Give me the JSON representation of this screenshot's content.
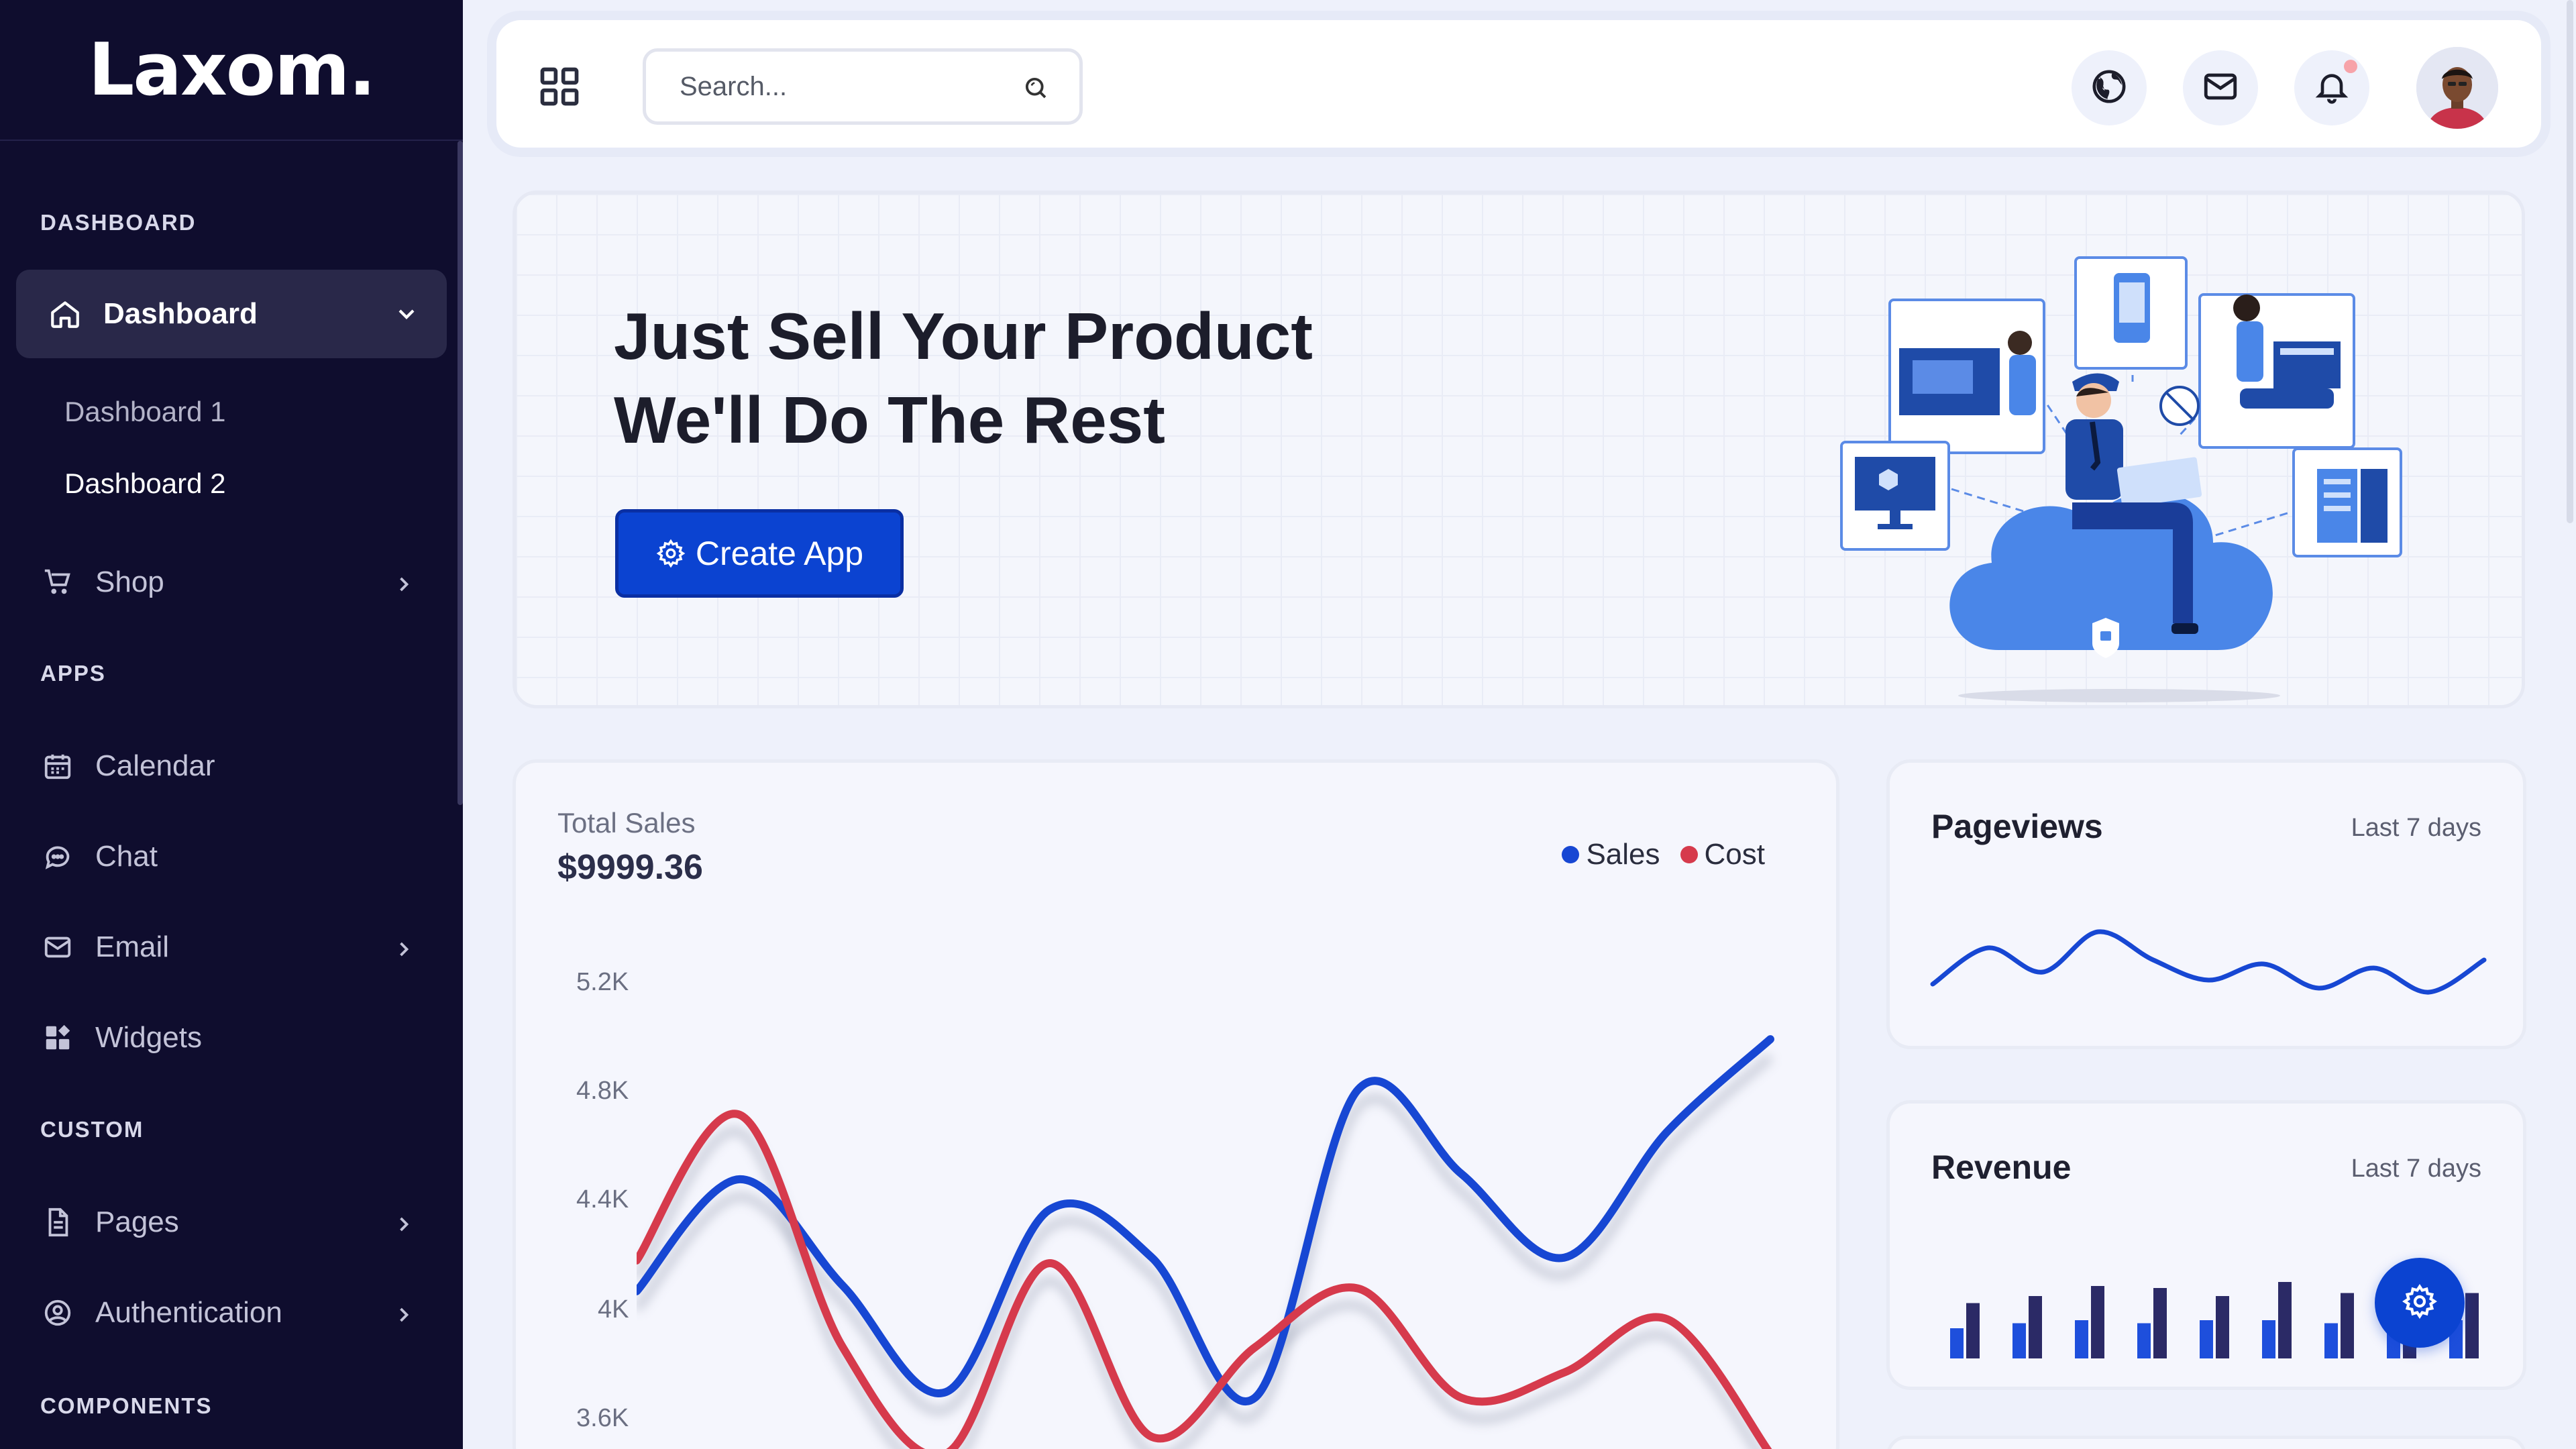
{
  "brand": {
    "logo": "Laxom."
  },
  "sidebar": {
    "sections": {
      "dashboard": "DASHBOARD",
      "apps": "APPS",
      "custom": "CUSTOM",
      "components": "COMPONENTS"
    },
    "active": {
      "label": "Dashboard",
      "icon": "home-icon"
    },
    "sub_items": [
      {
        "label": "Dashboard 1",
        "active": false
      },
      {
        "label": "Dashboard 2",
        "active": true
      }
    ],
    "items": [
      {
        "label": "Shop",
        "icon": "cart-icon",
        "has_children": true
      },
      {
        "label": "Calendar",
        "icon": "calendar-icon",
        "has_children": false
      },
      {
        "label": "Chat",
        "icon": "chat-icon",
        "has_children": false
      },
      {
        "label": "Email",
        "icon": "mail-icon",
        "has_children": true
      },
      {
        "label": "Widgets",
        "icon": "widgets-icon",
        "has_children": false
      },
      {
        "label": "Pages",
        "icon": "document-icon",
        "has_children": true
      },
      {
        "label": "Authentication",
        "icon": "user-circle-icon",
        "has_children": true
      }
    ]
  },
  "header": {
    "search_placeholder": "Search...",
    "icons": [
      "grid-icon",
      "globe-icon",
      "mail-icon",
      "bell-icon",
      "avatar"
    ]
  },
  "banner": {
    "title_line1": "Just Sell Your Product",
    "title_line2": "We'll Do The Rest",
    "button": "Create App"
  },
  "total_sales": {
    "label": "Total Sales",
    "value": "$9999.36",
    "legend": [
      {
        "name": "Sales",
        "color": "#1747d3"
      },
      {
        "name": "Cost",
        "color": "#d63a4c"
      }
    ],
    "y_ticks": [
      "5.2K",
      "4.8K",
      "4.4K",
      "4K",
      "3.6K"
    ]
  },
  "pageviews": {
    "title": "Pageviews",
    "period": "Last 7 days"
  },
  "revenue": {
    "title": "Revenue",
    "period": "Last 7 days"
  },
  "colors": {
    "sidebar_bg": "#0f0d2e",
    "accent": "#0b43d1",
    "sales": "#1747d3",
    "cost": "#d63a4c",
    "bar_light": "#1e4fdc",
    "bar_dark": "#2b2a66"
  },
  "chart_data": [
    {
      "type": "line",
      "title": "Total Sales",
      "ylim": [
        3500,
        5300
      ],
      "y_ticks": [
        5200,
        4800,
        4400,
        4000,
        3600
      ],
      "series": [
        {
          "name": "Sales",
          "values": [
            4180,
            4580,
            4200,
            3820,
            4470,
            4300,
            3800,
            4900,
            4600,
            4300,
            4750,
            5080
          ]
        },
        {
          "name": "Cost",
          "values": [
            4290,
            4810,
            3980,
            3600,
            4280,
            3660,
            3980,
            4190,
            3800,
            3890,
            4080,
            3600
          ]
        }
      ]
    },
    {
      "type": "line",
      "title": "Pageviews",
      "series": [
        {
          "name": "",
          "values": [
            40,
            58,
            46,
            66,
            52,
            42,
            50,
            38,
            48,
            36,
            52
          ]
        }
      ]
    },
    {
      "type": "bar",
      "title": "Revenue",
      "series": [
        {
          "name": "",
          "values": [
            30,
            35,
            38,
            35,
            38,
            38,
            35,
            35,
            38
          ]
        },
        {
          "name": "",
          "values": [
            55,
            62,
            72,
            70,
            62,
            76,
            65,
            68,
            65
          ]
        }
      ]
    }
  ]
}
